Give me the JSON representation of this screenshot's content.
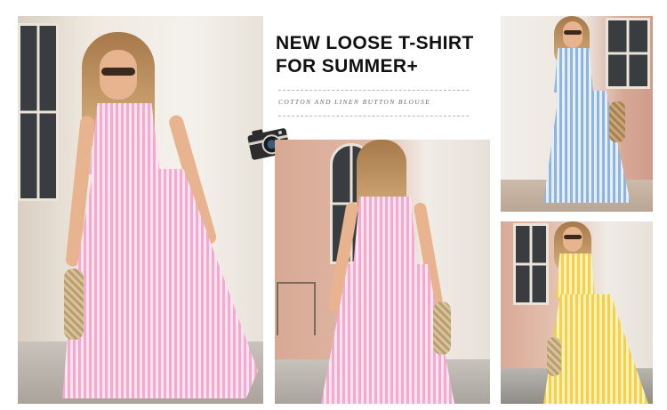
{
  "headline": {
    "line1": "NEW LOOSE T-SHIRT",
    "line2": "FOR SUMMER+"
  },
  "subtitle": "COTTON AND LINEN BUTTON BLOUSE",
  "icons": [
    "camera-icon"
  ],
  "photos": [
    {
      "id": "left",
      "dress_color": "pink and white stripes",
      "view": "front"
    },
    {
      "id": "center",
      "dress_color": "pink and white stripes",
      "view": "back"
    },
    {
      "id": "top-right",
      "dress_color": "blue and white stripes",
      "view": "front"
    },
    {
      "id": "bottom-right",
      "dress_color": "yellow and white stripes",
      "view": "front"
    }
  ],
  "colors": {
    "pink": "#f4a9cf",
    "blue": "#8fb4de",
    "yellow": "#f3d14a",
    "text": "#111111"
  }
}
